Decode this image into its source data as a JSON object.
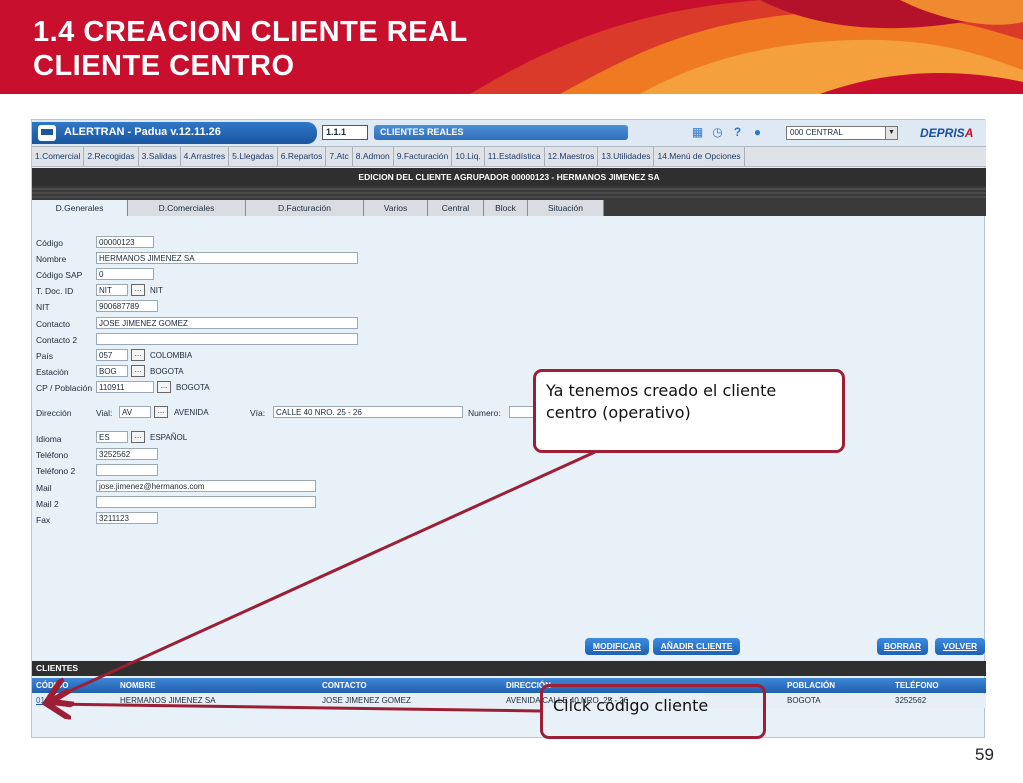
{
  "slide": {
    "title_line1": "1.4 CREACION CLIENTE REAL",
    "title_line2": "CLIENTE CENTRO",
    "page_number": "59",
    "colors": {
      "banner": "#c8102e",
      "callout_border": "#9b2035",
      "app_blue": "#1f5fae"
    }
  },
  "app": {
    "name": "ALERTRAN - Padua  v.12.11.26",
    "screen_code": "1.1.1",
    "screen_name": "CLIENTES REALES",
    "center_select": "000 CENTRAL",
    "brand_main": "DEPRIS",
    "brand_accent": "A",
    "toolbar_icons": [
      "calendar-icon",
      "clock-icon",
      "help-icon",
      "user-icon"
    ],
    "menu": [
      "1.Comercial",
      "2.Recogidas",
      "3.Salidas",
      "4.Arrastres",
      "5.Llegadas",
      "6.Repartos",
      "7.Atc",
      "8.Admon",
      "9.Facturación",
      "10.Liq.",
      "11.Estadística",
      "12.Maestros",
      "13.Utilidades",
      "14.Menú de Opciones"
    ],
    "subtitle": "EDICION DEL CLIENTE AGRUPADOR 00000123 - HERMANOS JIMENEZ SA",
    "tabs": [
      "D.Generales",
      "D.Comerciales",
      "D.Facturación",
      "Varios",
      "Central",
      "Block",
      "Situación"
    ],
    "active_tab": "D.Generales",
    "form": {
      "codigo_label": "Código",
      "codigo": "00000123",
      "nombre_label": "Nombre",
      "nombre": "HERMANOS JIMENEZ SA",
      "codigo_sap_label": "Código SAP",
      "codigo_sap": "0",
      "tdoc_label": "T. Doc. ID",
      "tdoc": "NIT",
      "tdoc_desc": "NIT",
      "nit_label": "NIT",
      "nit": "900687789",
      "contacto_label": "Contacto",
      "contacto": "JOSE JIMENEZ GOMEZ",
      "contacto2_label": "Contacto 2",
      "contacto2": "",
      "pais_label": "País",
      "pais": "057",
      "pais_desc": "COLOMBIA",
      "estacion_label": "Estación",
      "estacion": "BOG",
      "estacion_desc": "BOGOTA",
      "cp_label": "CP / Población",
      "cp": "110911",
      "cp_desc": "BOGOTA",
      "direccion_label": "Dirección",
      "vial_label": "Vial:",
      "vial": "AV",
      "vial_desc": "AVENIDA",
      "via_label": "Vía:",
      "via": "CALLE 40 NRO. 25 - 26",
      "numero_label": "Numero:",
      "numero": "",
      "idioma_label": "Idioma",
      "idioma": "ES",
      "idioma_desc": "ESPAÑOL",
      "telefono_label": "Teléfono",
      "telefono": "3252562",
      "telefono2_label": "Teléfono 2",
      "telefono2": "",
      "mail_label": "Mail",
      "mail": "jose.jimenez@hermanos.com",
      "mail2_label": "Mail 2",
      "mail2": "",
      "fax_label": "Fax",
      "fax": "3211123",
      "dots": "..."
    },
    "buttons": {
      "modificar": "MODIFICAR",
      "anadir": "AÑADIR CLIENTE",
      "borrar": "BORRAR",
      "volver": "VOLVER"
    },
    "clients": {
      "header": "CLIENTES",
      "columns": [
        "CÓDIGO",
        "NOMBRE",
        "CONTACTO",
        "DIRECCIÓN",
        "POBLACIÓN",
        "TELÉFONO"
      ],
      "rows": [
        {
          "codigo": "01",
          "nombre": "HERMANOS JIMENEZ SA",
          "contacto": "JOSE JIMENEZ GOMEZ",
          "direccion": "AVENIDA CALLE 40 NRO. 25 - 26",
          "poblacion": "BOGOTA",
          "telefono": "3252562"
        }
      ]
    }
  },
  "callouts": {
    "created": "Ya tenemos creado el cliente centro (operativo)",
    "click_code": "Click código cliente"
  }
}
